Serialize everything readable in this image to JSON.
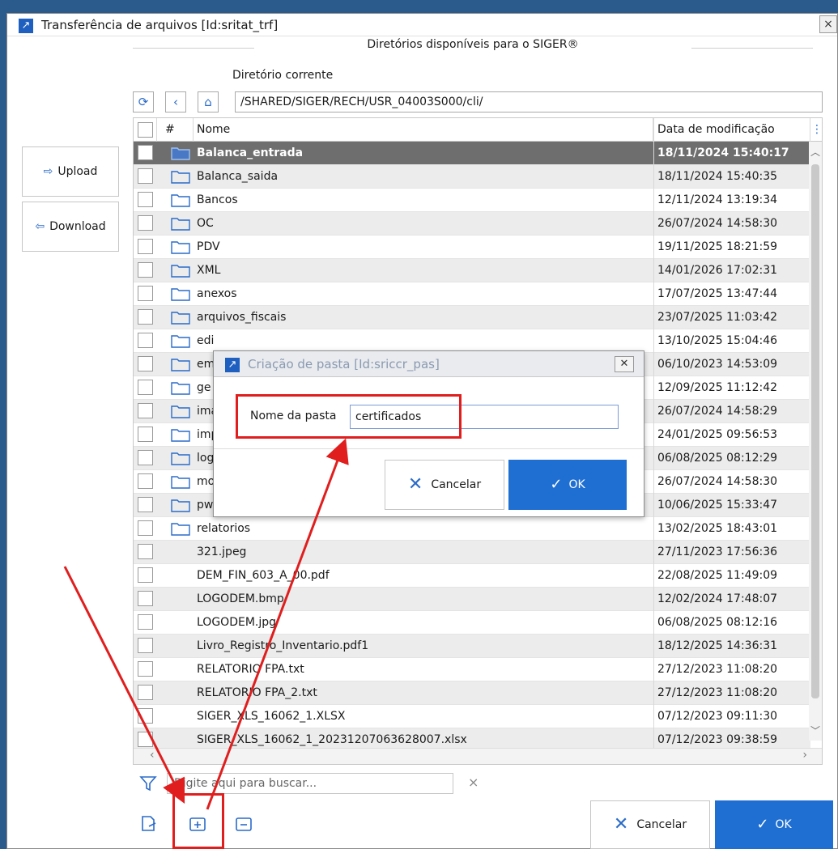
{
  "window": {
    "title": "Transferência de arquivos [Id:sritat_trf]",
    "close_label": "×"
  },
  "section_title": "Diretórios disponíveis para o SIGER®",
  "dir_label": "Diretório corrente",
  "path": "/SHARED/SIGER/RECH/USR_04003S000/cli/",
  "side_buttons": {
    "upload": "Upload",
    "download": "Download"
  },
  "table": {
    "headers": {
      "num": "#",
      "name": "Nome",
      "date": "Data de modificação"
    },
    "rows": [
      {
        "name": "Balanca_entrada",
        "date": "18/11/2024 15:40:17",
        "folder": true
      },
      {
        "name": "Balanca_saida",
        "date": "18/11/2024 15:40:35",
        "folder": true
      },
      {
        "name": "Bancos",
        "date": "12/11/2024 13:19:34",
        "folder": true
      },
      {
        "name": "OC",
        "date": "26/07/2024 14:58:30",
        "folder": true
      },
      {
        "name": "PDV",
        "date": "19/11/2025 18:21:59",
        "folder": true
      },
      {
        "name": "XML",
        "date": "14/01/2026 17:02:31",
        "folder": true
      },
      {
        "name": "anexos",
        "date": "17/07/2025 13:47:44",
        "folder": true
      },
      {
        "name": "arquivos_fiscais",
        "date": "23/07/2025 11:03:42",
        "folder": true
      },
      {
        "name": "edi",
        "date": "13/10/2025 15:04:46",
        "folder": true
      },
      {
        "name": "em",
        "date": "06/10/2023 14:53:09",
        "folder": true
      },
      {
        "name": "ge",
        "date": "12/09/2025 11:12:42",
        "folder": true
      },
      {
        "name": "ima",
        "date": "26/07/2024 14:58:29",
        "folder": true
      },
      {
        "name": "imp",
        "date": "24/01/2025 09:56:53",
        "folder": true
      },
      {
        "name": "log",
        "date": "06/08/2025 08:12:29",
        "folder": true
      },
      {
        "name": "mo",
        "date": "26/07/2024 14:58:30",
        "folder": true
      },
      {
        "name": "pw",
        "date": "10/06/2025 15:33:47",
        "folder": true
      },
      {
        "name": "relatorios",
        "date": "13/02/2025 18:43:01",
        "folder": true
      },
      {
        "name": "321.jpeg",
        "date": "27/11/2023 17:56:36",
        "folder": false
      },
      {
        "name": "DEM_FIN_603_A_00.pdf",
        "date": "22/08/2025 11:49:09",
        "folder": false
      },
      {
        "name": "LOGODEM.bmp",
        "date": "12/02/2024 17:48:07",
        "folder": false
      },
      {
        "name": "LOGODEM.jpg",
        "date": "06/08/2025 08:12:16",
        "folder": false
      },
      {
        "name": "Livro_Registro_Inventario.pdf1",
        "date": "18/12/2025 14:36:31",
        "folder": false
      },
      {
        "name": "RELATORIO FPA.txt",
        "date": "27/12/2023 11:08:20",
        "folder": false
      },
      {
        "name": "RELATORIO FPA_2.txt",
        "date": "27/12/2023 11:08:20",
        "folder": false
      },
      {
        "name": "SIGER_XLS_16062_1.XLSX",
        "date": "07/12/2023 09:11:30",
        "folder": false
      },
      {
        "name": "SIGER_XLS_16062_1_20231207063628007.xlsx",
        "date": "07/12/2023 09:38:59",
        "folder": false
      }
    ]
  },
  "search": {
    "placeholder": "Digite aqui para buscar..."
  },
  "bottom_buttons": {
    "cancel": "Cancelar",
    "ok": "OK"
  },
  "modal": {
    "title": "Criação de pasta [Id:sriccr_pas]",
    "field_label": "Nome da pasta",
    "field_value": "certificados",
    "cancel": "Cancelar",
    "ok": "OK"
  },
  "colors": {
    "accent": "#1f6fd3",
    "annotation": "#e01e1e",
    "selected_row": "#6e6e6e"
  }
}
